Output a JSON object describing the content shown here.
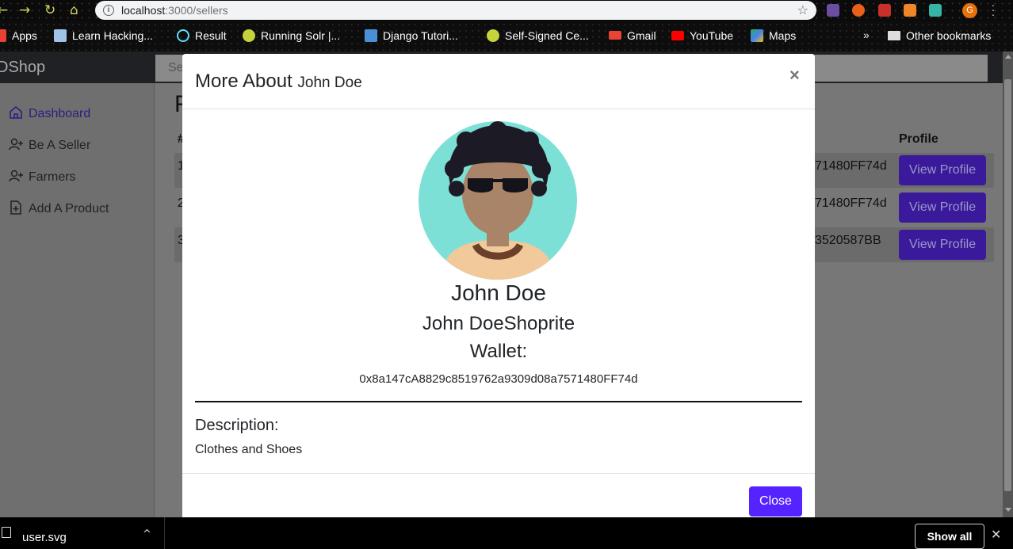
{
  "browser": {
    "url_host": "localhost",
    "url_path": ":3000/sellers",
    "profile_initial": "G",
    "bookmarks": [
      {
        "label": "Apps",
        "icon": "apps-grid-icon",
        "color": "#e94235"
      },
      {
        "label": "Learn Hacking...",
        "icon": "page-icon",
        "color": "#a0c4e8"
      },
      {
        "label": "Result",
        "icon": "react-icon",
        "color": "#61dafb"
      },
      {
        "label": "Running Solr |...",
        "icon": "globe-icon",
        "color": "#c6d33a"
      },
      {
        "label": "Django Tutori...",
        "icon": "django-icon",
        "color": "#4a90d9"
      },
      {
        "label": "Self-Signed Ce...",
        "icon": "globe-icon",
        "color": "#c6d33a"
      },
      {
        "label": "Gmail",
        "icon": "gmail-icon",
        "color": "#ea4335"
      },
      {
        "label": "YouTube",
        "icon": "youtube-icon",
        "color": "#ff0000"
      },
      {
        "label": "Maps",
        "icon": "maps-icon",
        "color": "#34a853"
      }
    ],
    "more_chevron": "»",
    "other_bookmarks": "Other bookmarks"
  },
  "app": {
    "brand": "DShop",
    "search_placeholder": "Se",
    "page_heading": "F",
    "sidebar": [
      {
        "label": "Dashboard",
        "icon": "home-icon",
        "active": true
      },
      {
        "label": "Be A Seller",
        "icon": "user-plus-icon",
        "active": false
      },
      {
        "label": "Farmers",
        "icon": "user-plus-icon",
        "active": false
      },
      {
        "label": "Add A Product",
        "icon": "file-plus-icon",
        "active": false
      }
    ],
    "table": {
      "headers": [
        "#",
        "Profile"
      ],
      "rows": [
        {
          "num": "1",
          "address": "71480FF74d",
          "button": "View Profile"
        },
        {
          "num": "2",
          "address": "71480FF74d",
          "button": "View Profile"
        },
        {
          "num": "3",
          "address": "3520587BB",
          "button": "View Profile"
        }
      ]
    }
  },
  "modal": {
    "title_prefix": "More About",
    "title_name": "John Doe",
    "close_x": "×",
    "name": "John Doe",
    "shop": "John DoeShoprite",
    "wallet_label": "Wallet:",
    "wallet": "0x8a147cA8829c8519762a9309d08a7571480FF74d",
    "description_label": "Description:",
    "description": "Clothes and Shoes",
    "close_button": "Close",
    "colors": {
      "accent": "#5523ff",
      "avatar_bg": "#7de0d6"
    }
  },
  "downloads": {
    "file": "user.svg",
    "caret": "^",
    "show_all": "Show all",
    "close": "✕"
  }
}
